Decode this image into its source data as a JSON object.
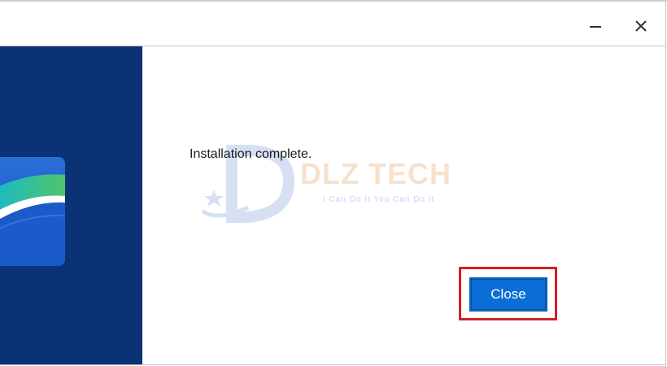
{
  "titlebar": {
    "minimize_icon": "minimize-icon",
    "close_icon": "close-icon"
  },
  "main": {
    "status_text": "Installation complete.",
    "close_label": "Close"
  },
  "watermark": {
    "title": "DLZ TECH",
    "subtitle": "I Can Do It You Can Do It"
  },
  "colors": {
    "side_panel": "#0b3275",
    "button": "#0a6ed6",
    "highlight": "#d41f26"
  }
}
